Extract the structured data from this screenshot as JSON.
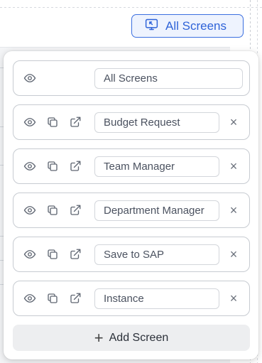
{
  "header": {
    "all_screens_button": "All Screens"
  },
  "panel": {
    "rows": [
      {
        "name": "All Screens",
        "removable": false
      },
      {
        "name": "Budget Request",
        "removable": true
      },
      {
        "name": "Team Manager",
        "removable": true
      },
      {
        "name": "Department Manager",
        "removable": true
      },
      {
        "name": "Save to SAP",
        "removable": true
      },
      {
        "name": "Instance",
        "removable": true
      }
    ],
    "close_glyph": "×",
    "add_button_label": "Add Screen",
    "add_button_icon": "+"
  },
  "colors": {
    "accent": "#2f63d8",
    "accent_bg": "#eef3fe"
  }
}
